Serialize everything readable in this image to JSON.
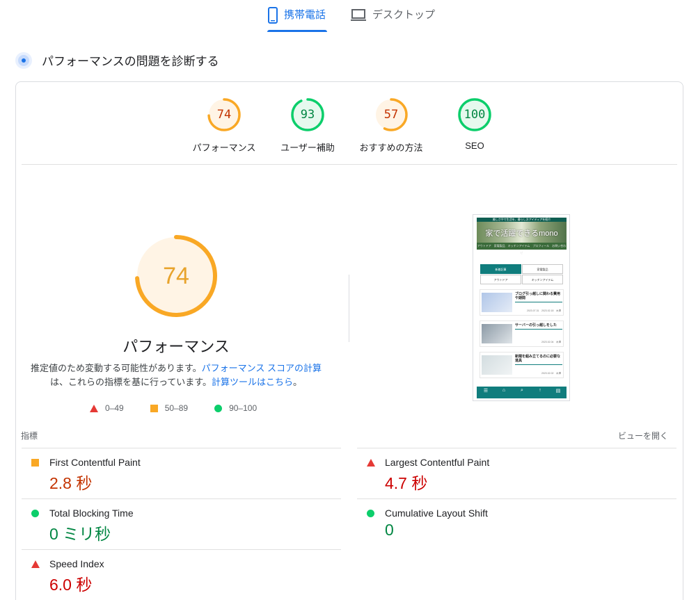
{
  "tabs": {
    "mobile": "携帯電話",
    "desktop": "デスクトップ"
  },
  "diagnose": {
    "title": "パフォーマンスの問題を診断する"
  },
  "gauges": [
    {
      "label": "パフォーマンス",
      "score": "74",
      "level": "average"
    },
    {
      "label": "ユーザー補助",
      "score": "93",
      "level": "pass"
    },
    {
      "label": "おすすめの方法",
      "score": "57",
      "level": "average"
    },
    {
      "label": "SEO",
      "score": "100",
      "level": "pass"
    }
  ],
  "main_gauge": {
    "score": "74",
    "score_fraction": 0.74,
    "title": "パフォーマンス"
  },
  "description": {
    "text1": "推定値のため変動する可能性があります。",
    "link1": "パフォーマンス スコアの計算",
    "text2": "は、これらの指標を基に行っています。",
    "link2": "計算ツールはこちら",
    "text3": "。"
  },
  "legend": {
    "fail": "0–49",
    "average": "50–89",
    "pass": "90–100"
  },
  "preview": {
    "topbar": "美しさやで生活を、暮らし方アイディアを紹介",
    "hero_title": "家で活躍できるmono",
    "subnav": "アウトドア　家電製品　キッチンアイテム　プロフィール　お問い合わせ",
    "tabs": [
      "新着記事",
      "家電製品",
      "アウトドア",
      "キッチンアイテム"
    ],
    "posts": [
      {
        "title": "ブログ引っ越しに関わる費用や期間",
        "date": "2023.07.31　2023.02.18　木澤"
      },
      {
        "title": "サーバーの引っ越しをした",
        "date": "2023.02.04　木澤"
      },
      {
        "title": "新聞を組み立てるのに必要な道具",
        "date": "2023.02.02　木澤"
      }
    ]
  },
  "metrics_header": {
    "label": "指標",
    "expand": "ビューを開く"
  },
  "metrics": {
    "fcp": {
      "name": "First Contentful Paint",
      "value": "2.8 秒",
      "status": "average"
    },
    "lcp": {
      "name": "Largest Contentful Paint",
      "value": "4.7 秒",
      "status": "fail"
    },
    "tbt": {
      "name": "Total Blocking Time",
      "value": "0 ミリ秒",
      "status": "pass"
    },
    "cls": {
      "name": "Cumulative Layout Shift",
      "value": "0",
      "status": "pass"
    },
    "si": {
      "name": "Speed Index",
      "value": "6.0 秒",
      "status": "fail"
    }
  },
  "colors": {
    "accent": "#1a73e8",
    "pass": "#0cce6b",
    "average": "#ffa400",
    "fail": "#ff4e42"
  }
}
